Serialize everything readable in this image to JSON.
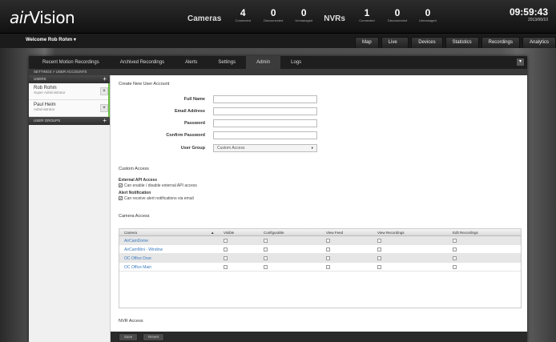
{
  "app": {
    "logo_prefix": "air",
    "logo_suffix": "Vision"
  },
  "stats": {
    "cameras_label": "Cameras",
    "cameras": [
      {
        "value": "4",
        "label": "Connected"
      },
      {
        "value": "0",
        "label": "Disconnected"
      },
      {
        "value": "0",
        "label": "Unmanaged"
      }
    ],
    "nvrs_label": "NVRs",
    "nvrs": [
      {
        "value": "1",
        "label": "Connected"
      },
      {
        "value": "0",
        "label": "Disconnected"
      },
      {
        "value": "0",
        "label": "Unmanaged"
      }
    ]
  },
  "clock": {
    "time": "09:59:43",
    "date": "2013/06/10"
  },
  "header": {
    "welcome": "Welcome Rob Rohm ▾"
  },
  "main_tabs": [
    "Map",
    "Live View",
    "Devices",
    "Statistics",
    "Recordings",
    "Analytics"
  ],
  "sub_tabs": [
    "Recent Motion Recordings",
    "Archived Recordings",
    "Alerts",
    "Settings",
    "Admin",
    "Logs"
  ],
  "breadcrumb": "SETTINGS > USER ACCOUNTS",
  "sidebar": {
    "users_header": "USERS",
    "users": [
      {
        "name": "Rob Rohm",
        "role": "Super Administrator"
      },
      {
        "name": "Paul Heim",
        "role": "Administrator"
      }
    ],
    "groups_header": "USER GROUPS"
  },
  "form": {
    "title": "Create New User Account",
    "fields": [
      {
        "label": "Full Name",
        "value": ""
      },
      {
        "label": "Email Address",
        "value": ""
      },
      {
        "label": "Password",
        "value": ""
      },
      {
        "label": "Confirm Password",
        "value": ""
      }
    ],
    "group_label": "User Group",
    "group_value": "Custom Access"
  },
  "custom_access": {
    "title": "Custom Access",
    "api_title": "External API Access",
    "api_text": "Can enable / disable external API access",
    "alert_title": "Alert Notification",
    "alert_text": "Can receive alert notifications via email"
  },
  "camera_access": {
    "title": "Camera Access",
    "columns": [
      "Camera",
      "Visible",
      "Configurable",
      "View Feed",
      "View Recordings",
      "Edit Recordings"
    ],
    "rows": [
      "AirCamDome",
      "AirCamMini - Window",
      "OC Office Door",
      "OC Office Main"
    ]
  },
  "nvr_access": {
    "title": "NVR Access"
  },
  "footer": {
    "save": "Save",
    "revert": "Revert"
  }
}
